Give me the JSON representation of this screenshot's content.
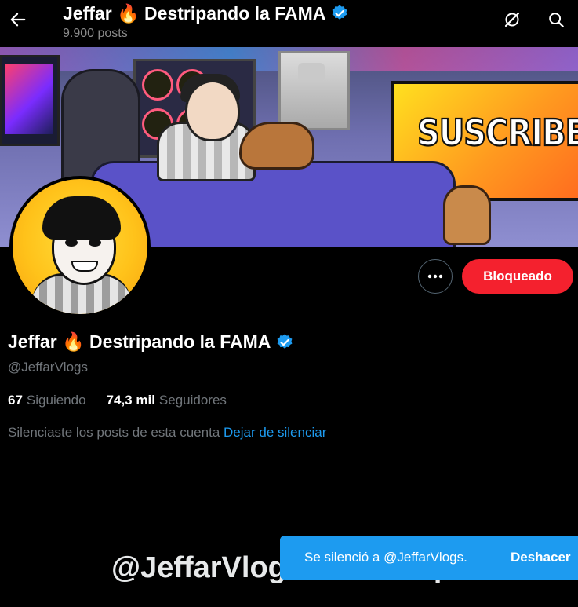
{
  "header": {
    "title": "Jeffar 🔥 Destripando la FAMA",
    "post_count": "9.900 posts",
    "icons": [
      "back-arrow-icon",
      "grok-icon",
      "search-icon"
    ]
  },
  "banner": {
    "tv_text": "SUSCRIBETE"
  },
  "profile": {
    "display_name": "Jeffar 🔥 Destripando la FAMA",
    "handle": "@JeffarVlogs",
    "following_count": "67",
    "following_label": "Siguiendo",
    "followers_count": "74,3 mil",
    "followers_label": "Seguidores",
    "muted_notice": "Silenciaste los posts de esta cuenta",
    "unmute_link": "Dejar de silenciar",
    "verified_color": "#1d9bf0"
  },
  "actions": {
    "more_label": "···",
    "blocked_label": "Bloqueado",
    "blocked_color": "#f4212e"
  },
  "blocked_section": {
    "heading": "@JeffarVlogs está bloqueado"
  },
  "toast": {
    "message": "Se silenció a @JeffarVlogs.",
    "undo_label": "Deshacer",
    "color": "#1d9bf0"
  }
}
